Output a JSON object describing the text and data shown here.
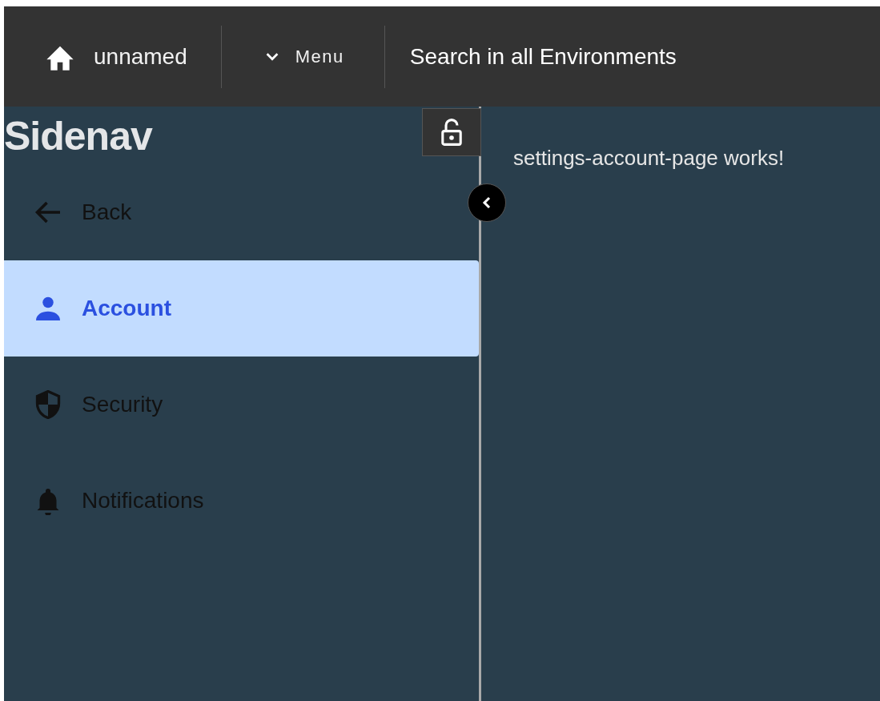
{
  "top_bar": {
    "project": "unnamed",
    "menu": {
      "label": "Menu",
      "expanded": false
    },
    "search": "Search in all Environments"
  },
  "sidenav": {
    "title": "Sidenav",
    "locked": false,
    "items": [
      {
        "kind": "back",
        "label": "Back",
        "selected": false
      },
      {
        "kind": "account",
        "label": "Account",
        "selected": true
      },
      {
        "kind": "security",
        "label": "Security",
        "selected": false
      },
      {
        "kind": "notifications",
        "label": "Notifications",
        "selected": false
      }
    ]
  },
  "content": {
    "message": "settings-account-page works!"
  }
}
